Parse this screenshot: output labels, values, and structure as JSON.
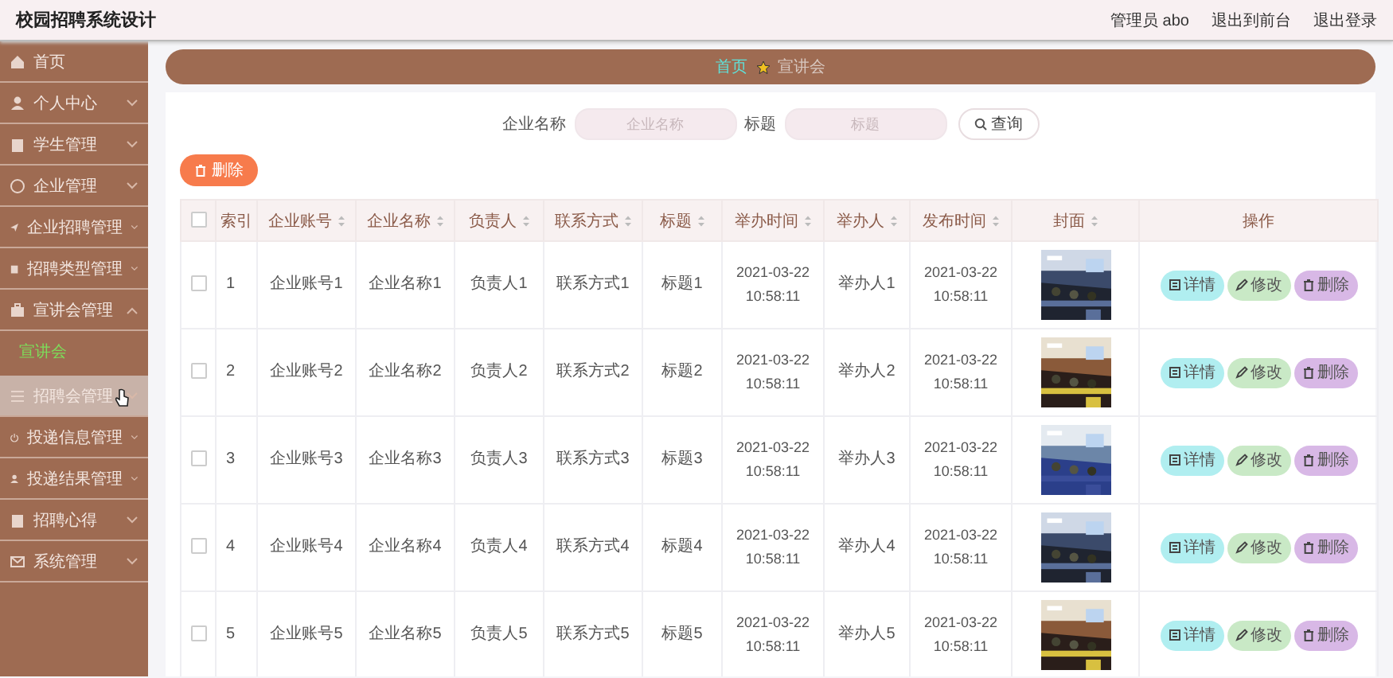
{
  "app": {
    "title": "校园招聘系统设计"
  },
  "header": {
    "user": "管理员 abo",
    "links": [
      "退出到前台",
      "退出登录"
    ]
  },
  "sidebar": {
    "items": [
      {
        "label": "首页",
        "hovered": false
      },
      {
        "label": "个人中心",
        "expanded": false,
        "hovered": false
      },
      {
        "label": "学生管理",
        "expanded": false,
        "hovered": false
      },
      {
        "label": "企业管理",
        "expanded": false,
        "hovered": false
      },
      {
        "label": "企业招聘管理",
        "expanded": false,
        "hovered": false
      },
      {
        "label": "招聘类型管理",
        "expanded": false,
        "hovered": false
      },
      {
        "label": "宣讲会管理",
        "expanded": true,
        "hovered": false,
        "children": [
          {
            "label": "宣讲会",
            "selected": true
          }
        ]
      },
      {
        "label": "招聘会管理",
        "expanded": false,
        "hovered": true
      },
      {
        "label": "投递信息管理",
        "expanded": false,
        "hovered": false
      },
      {
        "label": "投递结果管理",
        "expanded": false,
        "hovered": false
      },
      {
        "label": "招聘心得",
        "expanded": false,
        "hovered": false
      },
      {
        "label": "系统管理",
        "expanded": false,
        "hovered": false
      }
    ]
  },
  "breadcrumb": [
    "首页",
    "宣讲会"
  ],
  "search": {
    "fields": [
      {
        "label": "企业名称",
        "placeholder": "企业名称"
      },
      {
        "label": "标题",
        "placeholder": "标题"
      }
    ],
    "button": "查询"
  },
  "delete_button": "删除",
  "table": {
    "select_all": {
      "checked": false
    },
    "columns": [
      {
        "label": "索引",
        "sortable": false
      },
      {
        "label": "企业账号",
        "sortable": true
      },
      {
        "label": "企业名称",
        "sortable": true
      },
      {
        "label": "负责人",
        "sortable": true
      },
      {
        "label": "联系方式",
        "sortable": true
      },
      {
        "label": "标题",
        "sortable": true
      },
      {
        "label": "举办时间",
        "sortable": true
      },
      {
        "label": "举办人",
        "sortable": true
      },
      {
        "label": "发布时间",
        "sortable": true
      },
      {
        "label": "封面",
        "sortable": true
      },
      {
        "label": "操作",
        "sortable": false
      }
    ],
    "rows": [
      {
        "checked": false,
        "cells": [
          "1",
          "企业账号1",
          "企业名称1",
          "负责人1",
          "联系方式1",
          "标题1",
          "2021-03-22 10:58:11",
          "举办人1",
          "2021-03-22 10:58:11"
        ],
        "actions": [
          "详情",
          "修改",
          "删除"
        ]
      },
      {
        "checked": false,
        "cells": [
          "2",
          "企业账号2",
          "企业名称2",
          "负责人2",
          "联系方式2",
          "标题2",
          "2021-03-22 10:58:11",
          "举办人2",
          "2021-03-22 10:58:11"
        ],
        "actions": [
          "详情",
          "修改",
          "删除"
        ]
      },
      {
        "checked": false,
        "cells": [
          "3",
          "企业账号3",
          "企业名称3",
          "负责人3",
          "联系方式3",
          "标题3",
          "2021-03-22 10:58:11",
          "举办人3",
          "2021-03-22 10:58:11"
        ],
        "actions": [
          "详情",
          "修改",
          "删除"
        ]
      },
      {
        "checked": false,
        "cells": [
          "4",
          "企业账号4",
          "企业名称4",
          "负责人4",
          "联系方式4",
          "标题4",
          "2021-03-22 10:58:11",
          "举办人4",
          "2021-03-22 10:58:11"
        ],
        "actions": [
          "详情",
          "修改",
          "删除"
        ]
      },
      {
        "checked": false,
        "cells": [
          "5",
          "企业账号5",
          "企业名称5",
          "负责人5",
          "联系方式5",
          "标题5",
          "2021-03-22 10:58:11",
          "举办人5",
          "2021-03-22 10:58:11"
        ],
        "actions": [
          "详情",
          "修改",
          "删除"
        ]
      }
    ]
  }
}
